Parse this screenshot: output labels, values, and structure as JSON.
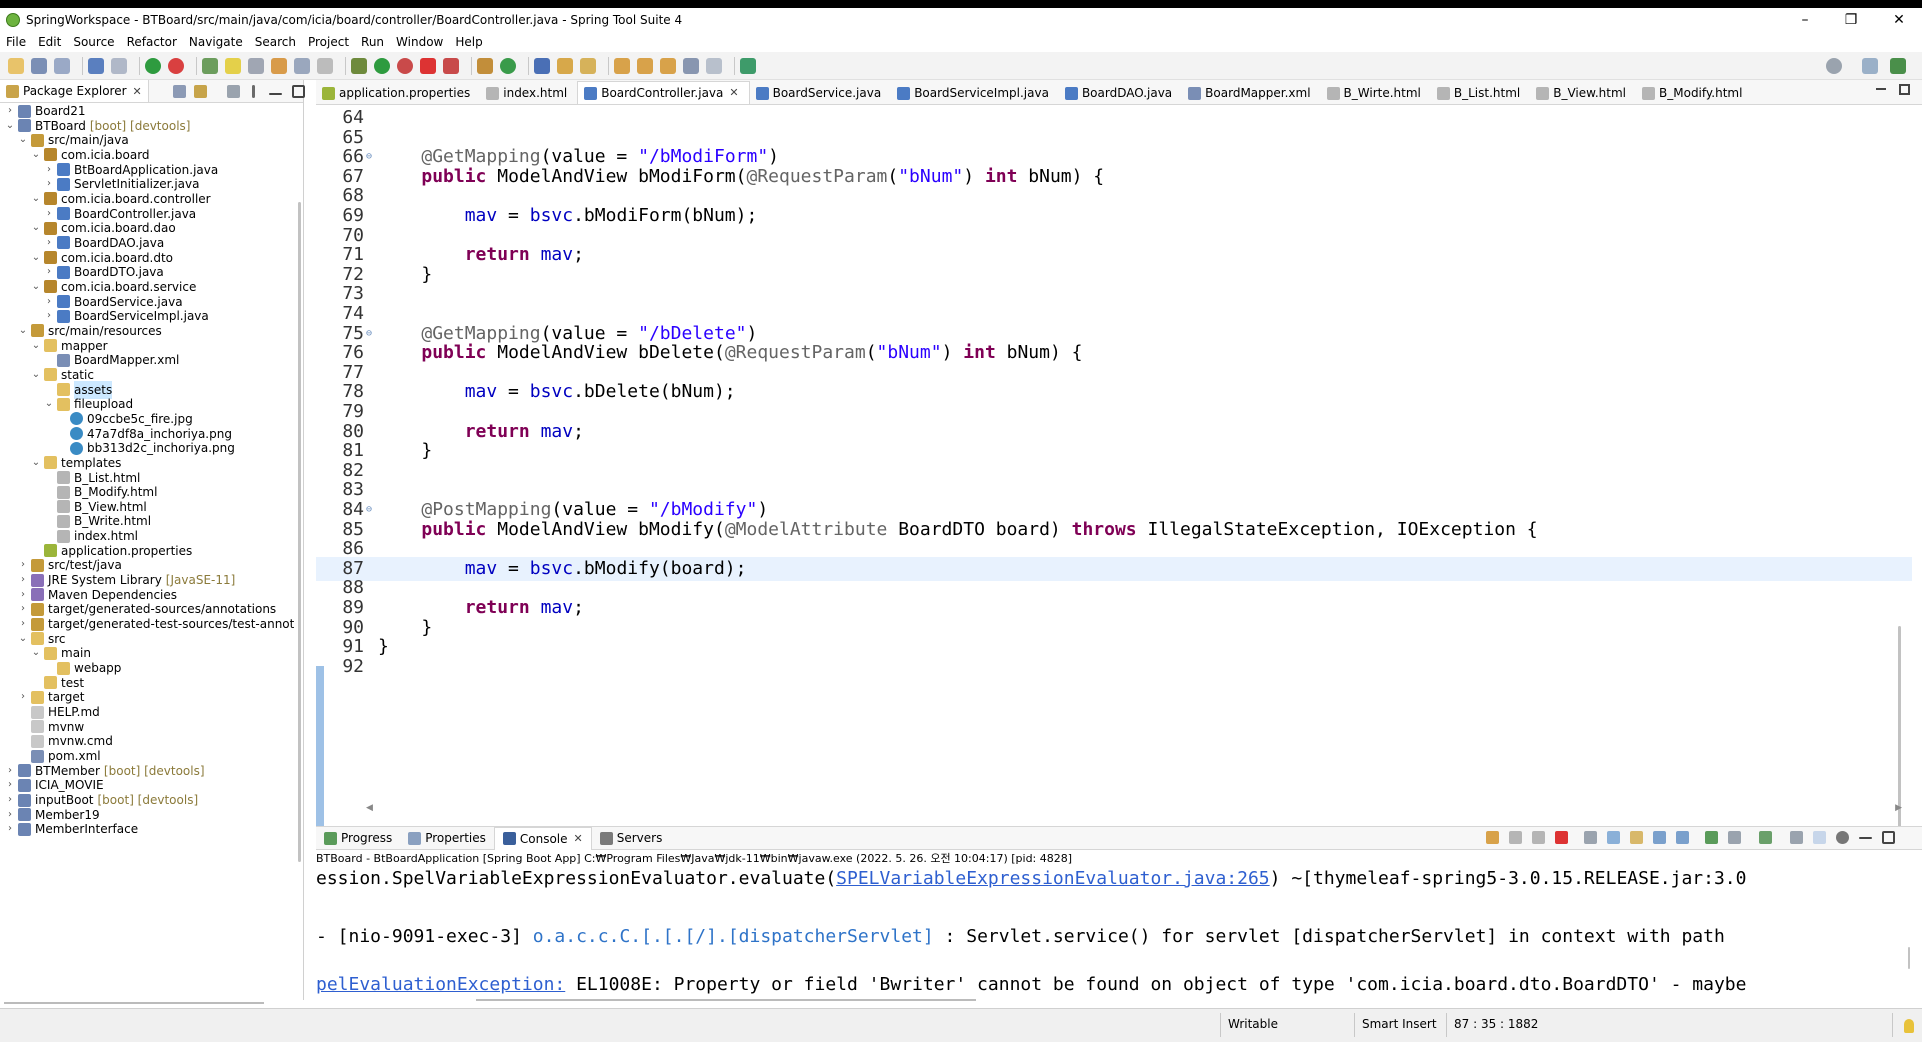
{
  "window": {
    "title": "SpringWorkspace - BTBoard/src/main/java/com/icia/board/controller/BoardController.java - Spring Tool Suite 4",
    "minimize": "–",
    "maximize": "❐",
    "close": "✕"
  },
  "menu": [
    "File",
    "Edit",
    "Source",
    "Refactor",
    "Navigate",
    "Search",
    "Project",
    "Run",
    "Window",
    "Help"
  ],
  "explorer": {
    "tab_label": "Package Explorer",
    "rows": [
      {
        "indent": 0,
        "twisty": "›",
        "icon": "project",
        "label": "Board21",
        "deco": ""
      },
      {
        "indent": 0,
        "twisty": "⌄",
        "icon": "project",
        "label": "BTBoard",
        "deco": "[boot] [devtools]"
      },
      {
        "indent": 1,
        "twisty": "⌄",
        "icon": "srcfolder",
        "label": "src/main/java",
        "deco": ""
      },
      {
        "indent": 2,
        "twisty": "⌄",
        "icon": "package",
        "label": "com.icia.board",
        "deco": ""
      },
      {
        "indent": 3,
        "twisty": "›",
        "icon": "java",
        "label": "BtBoardApplication.java",
        "deco": ""
      },
      {
        "indent": 3,
        "twisty": "›",
        "icon": "java",
        "label": "ServletInitializer.java",
        "deco": ""
      },
      {
        "indent": 2,
        "twisty": "⌄",
        "icon": "package",
        "label": "com.icia.board.controller",
        "deco": ""
      },
      {
        "indent": 3,
        "twisty": "›",
        "icon": "java",
        "label": "BoardController.java",
        "deco": ""
      },
      {
        "indent": 2,
        "twisty": "⌄",
        "icon": "package",
        "label": "com.icia.board.dao",
        "deco": ""
      },
      {
        "indent": 3,
        "twisty": "›",
        "icon": "java",
        "label": "BoardDAO.java",
        "deco": ""
      },
      {
        "indent": 2,
        "twisty": "⌄",
        "icon": "package",
        "label": "com.icia.board.dto",
        "deco": ""
      },
      {
        "indent": 3,
        "twisty": "›",
        "icon": "java",
        "label": "BoardDTO.java",
        "deco": ""
      },
      {
        "indent": 2,
        "twisty": "⌄",
        "icon": "package",
        "label": "com.icia.board.service",
        "deco": ""
      },
      {
        "indent": 3,
        "twisty": "›",
        "icon": "java",
        "label": "BoardService.java",
        "deco": ""
      },
      {
        "indent": 3,
        "twisty": "›",
        "icon": "java",
        "label": "BoardServiceImpl.java",
        "deco": ""
      },
      {
        "indent": 1,
        "twisty": "⌄",
        "icon": "srcfolder",
        "label": "src/main/resources",
        "deco": ""
      },
      {
        "indent": 2,
        "twisty": "⌄",
        "icon": "folder",
        "label": "mapper",
        "deco": ""
      },
      {
        "indent": 3,
        "twisty": "",
        "icon": "xml",
        "label": "BoardMapper.xml",
        "deco": ""
      },
      {
        "indent": 2,
        "twisty": "⌄",
        "icon": "folder",
        "label": "static",
        "deco": ""
      },
      {
        "indent": 3,
        "twisty": "",
        "icon": "folder",
        "label": "assets",
        "deco": "",
        "selected": true
      },
      {
        "indent": 3,
        "twisty": "⌄",
        "icon": "folder",
        "label": "fileupload",
        "deco": ""
      },
      {
        "indent": 4,
        "twisty": "",
        "icon": "image",
        "label": "09ccbe5c_fire.jpg",
        "deco": ""
      },
      {
        "indent": 4,
        "twisty": "",
        "icon": "image",
        "label": "47a7df8a_inchoriya.png",
        "deco": ""
      },
      {
        "indent": 4,
        "twisty": "",
        "icon": "image",
        "label": "bb313d2c_inchoriya.png",
        "deco": ""
      },
      {
        "indent": 2,
        "twisty": "⌄",
        "icon": "folder",
        "label": "templates",
        "deco": ""
      },
      {
        "indent": 3,
        "twisty": "",
        "icon": "html",
        "label": "B_List.html",
        "deco": ""
      },
      {
        "indent": 3,
        "twisty": "",
        "icon": "html",
        "label": "B_Modify.html",
        "deco": ""
      },
      {
        "indent": 3,
        "twisty": "",
        "icon": "html",
        "label": "B_View.html",
        "deco": ""
      },
      {
        "indent": 3,
        "twisty": "",
        "icon": "html",
        "label": "B_Write.html",
        "deco": ""
      },
      {
        "indent": 3,
        "twisty": "",
        "icon": "html",
        "label": "index.html",
        "deco": ""
      },
      {
        "indent": 2,
        "twisty": "",
        "icon": "props",
        "label": "application.properties",
        "deco": ""
      },
      {
        "indent": 1,
        "twisty": "›",
        "icon": "srcfolder",
        "label": "src/test/java",
        "deco": ""
      },
      {
        "indent": 1,
        "twisty": "›",
        "icon": "library",
        "label": "JRE System Library",
        "deco": "[JavaSE-11]"
      },
      {
        "indent": 1,
        "twisty": "›",
        "icon": "library",
        "label": "Maven Dependencies",
        "deco": ""
      },
      {
        "indent": 1,
        "twisty": "›",
        "icon": "srcfolder",
        "label": "target/generated-sources/annotations",
        "deco": ""
      },
      {
        "indent": 1,
        "twisty": "›",
        "icon": "srcfolder",
        "label": "target/generated-test-sources/test-annotatic",
        "deco": ""
      },
      {
        "indent": 1,
        "twisty": "⌄",
        "icon": "folder",
        "label": "src",
        "deco": ""
      },
      {
        "indent": 2,
        "twisty": "⌄",
        "icon": "folder",
        "label": "main",
        "deco": ""
      },
      {
        "indent": 3,
        "twisty": "",
        "icon": "folder",
        "label": "webapp",
        "deco": ""
      },
      {
        "indent": 2,
        "twisty": "",
        "icon": "folder",
        "label": "test",
        "deco": ""
      },
      {
        "indent": 1,
        "twisty": "›",
        "icon": "folder",
        "label": "target",
        "deco": ""
      },
      {
        "indent": 1,
        "twisty": "",
        "icon": "file",
        "label": "HELP.md",
        "deco": ""
      },
      {
        "indent": 1,
        "twisty": "",
        "icon": "file",
        "label": "mvnw",
        "deco": ""
      },
      {
        "indent": 1,
        "twisty": "",
        "icon": "file",
        "label": "mvnw.cmd",
        "deco": ""
      },
      {
        "indent": 1,
        "twisty": "",
        "icon": "xml",
        "label": "pom.xml",
        "deco": ""
      },
      {
        "indent": 0,
        "twisty": "›",
        "icon": "project",
        "label": "BTMember",
        "deco": "[boot] [devtools]"
      },
      {
        "indent": 0,
        "twisty": "›",
        "icon": "project",
        "label": "ICIA_MOVIE",
        "deco": ""
      },
      {
        "indent": 0,
        "twisty": "›",
        "icon": "project",
        "label": "inputBoot",
        "deco": "[boot] [devtools]"
      },
      {
        "indent": 0,
        "twisty": "›",
        "icon": "project",
        "label": "Member19",
        "deco": ""
      },
      {
        "indent": 0,
        "twisty": "›",
        "icon": "project",
        "label": "MemberInterface",
        "deco": ""
      }
    ]
  },
  "editor_tabs": [
    {
      "label": "application.properties",
      "icon": "props",
      "active": false
    },
    {
      "label": "index.html",
      "icon": "html",
      "active": false
    },
    {
      "label": "BoardController.java",
      "icon": "java",
      "active": true
    },
    {
      "label": "BoardService.java",
      "icon": "java",
      "active": false
    },
    {
      "label": "BoardServiceImpl.java",
      "icon": "java",
      "active": false
    },
    {
      "label": "BoardDAO.java",
      "icon": "java",
      "active": false
    },
    {
      "label": "BoardMapper.xml",
      "icon": "xml",
      "active": false
    },
    {
      "label": "B_Wirte.html",
      "icon": "html",
      "active": false
    },
    {
      "label": "B_List.html",
      "icon": "html",
      "active": false
    },
    {
      "label": "B_View.html",
      "icon": "html",
      "active": false
    },
    {
      "label": "B_Modify.html",
      "icon": "html",
      "active": false
    }
  ],
  "code_lines": [
    {
      "n": "64",
      "fold": "",
      "html": ""
    },
    {
      "n": "65",
      "fold": "",
      "html": ""
    },
    {
      "n": "66",
      "fold": "⊖",
      "html": "    <span class=\"ann\">@GetMapping</span>(value = <span class=\"str\">\"/bModiForm\"</span>)"
    },
    {
      "n": "67",
      "fold": "",
      "html": "    <span class=\"kw\">public</span> ModelAndView bModiForm(<span class=\"ann\">@RequestParam</span>(<span class=\"str\">\"bNum\"</span>) <span class=\"kw\">int</span> bNum) {"
    },
    {
      "n": "68",
      "fold": "",
      "html": ""
    },
    {
      "n": "69",
      "fold": "",
      "html": "        <span class=\"fld\">mav</span> = <span class=\"fld\">bsvc</span>.bModiForm(bNum);"
    },
    {
      "n": "70",
      "fold": "",
      "html": ""
    },
    {
      "n": "71",
      "fold": "",
      "html": "        <span class=\"kw\">return</span> <span class=\"fld\">mav</span>;"
    },
    {
      "n": "72",
      "fold": "",
      "html": "    }"
    },
    {
      "n": "73",
      "fold": "",
      "html": ""
    },
    {
      "n": "74",
      "fold": "",
      "html": ""
    },
    {
      "n": "75",
      "fold": "⊖",
      "html": "    <span class=\"ann\">@GetMapping</span>(value = <span class=\"str\">\"/bDelete\"</span>)"
    },
    {
      "n": "76",
      "fold": "",
      "html": "    <span class=\"kw\">public</span> ModelAndView bDelete(<span class=\"ann\">@RequestParam</span>(<span class=\"str\">\"bNum\"</span>) <span class=\"kw\">int</span> bNum) {"
    },
    {
      "n": "77",
      "fold": "",
      "html": ""
    },
    {
      "n": "78",
      "fold": "",
      "html": "        <span class=\"fld\">mav</span> = <span class=\"fld\">bsvc</span>.bDelete(bNum);"
    },
    {
      "n": "79",
      "fold": "",
      "html": ""
    },
    {
      "n": "80",
      "fold": "",
      "html": "        <span class=\"kw\">return</span> <span class=\"fld\">mav</span>;"
    },
    {
      "n": "81",
      "fold": "",
      "html": "    }"
    },
    {
      "n": "82",
      "fold": "",
      "html": ""
    },
    {
      "n": "83",
      "fold": "",
      "html": ""
    },
    {
      "n": "84",
      "fold": "⊖",
      "html": "    <span class=\"ann\">@PostMapping</span>(value = <span class=\"str\">\"/bModify\"</span>)"
    },
    {
      "n": "85",
      "fold": "",
      "html": "    <span class=\"kw\">public</span> ModelAndView bModify(<span class=\"ann\">@ModelAttribute</span> BoardDTO board) <span class=\"kw\">throws</span> IllegalStateException, IOException {"
    },
    {
      "n": "86",
      "fold": "",
      "html": ""
    },
    {
      "n": "87",
      "fold": "",
      "html": "        <span class=\"fld\">mav</span> = <span class=\"fld\">bsvc</span>.bModify(board);",
      "current": true
    },
    {
      "n": "88",
      "fold": "",
      "html": ""
    },
    {
      "n": "89",
      "fold": "",
      "html": "        <span class=\"kw\">return</span> <span class=\"fld\">mav</span>;"
    },
    {
      "n": "90",
      "fold": "",
      "html": "    }"
    },
    {
      "n": "91",
      "fold": "",
      "html": "}"
    },
    {
      "n": "92",
      "fold": "",
      "html": ""
    }
  ],
  "console": {
    "tabs": [
      {
        "label": "Progress",
        "icon": "progress",
        "active": false
      },
      {
        "label": "Properties",
        "icon": "properties",
        "active": false
      },
      {
        "label": "Console",
        "icon": "console",
        "active": true
      },
      {
        "label": "Servers",
        "icon": "servers",
        "active": false
      }
    ],
    "header": "BTBoard - BtBoardApplication [Spring Boot App] C:₩Program Files₩Java₩jdk-11₩bin₩javaw.exe  (2022. 5. 26. 오전 10:04:17) [pid: 4828]",
    "line1_html": "<span>ession.SpelVariableExpressionEvaluator.evaluate(</span><span class=\"link\">SPELVariableExpressionEvaluator.java:265</span><span>) ~[thymeleaf-spring5-3.0.15.RELEASE.jar:3.0</span>",
    "line2_html": "<span>- [nio-9091-exec-3] </span><span class=\"logger\">o.a.c.c.C.[.[.[/].[dispatcherServlet]</span><span>    : Servlet.service() for servlet [dispatcherServlet] in context with path</span>",
    "line3_html": "<span class=\"link\">pelEvaluationException:</span><span> EL1008E: Property or field 'Bwriter' cannot be found on object of type 'com.icia.board.dto.BoardDTO' - maybe</span>"
  },
  "status": {
    "writable": "Writable",
    "insert_mode": "Smart Insert",
    "position": "87 : 35 : 1882"
  },
  "colors": {
    "keyword": "#7f0055",
    "annotation": "#646464",
    "string": "#2a00ff",
    "field": "#0000c0",
    "current_line": "#e8f2fe"
  }
}
